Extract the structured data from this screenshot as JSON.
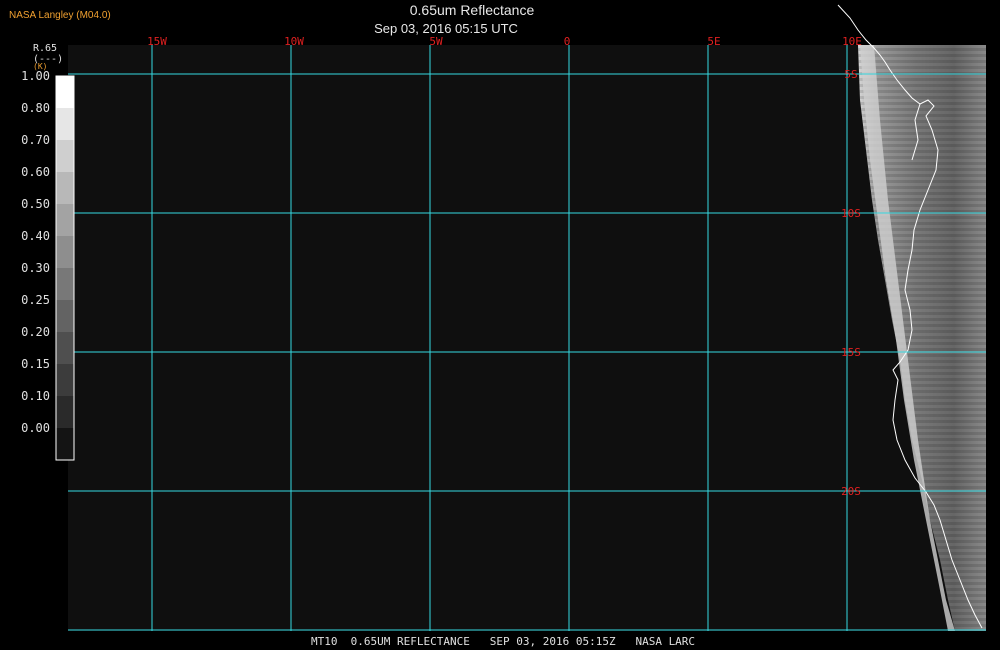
{
  "header": {
    "organization": "NASA Langley (M04.0)",
    "title": "0.65um Reflectance",
    "subtitle": "Sep 03, 2016 05:15 UTC"
  },
  "legend": {
    "variable": "R.65",
    "units": "(---)",
    "units_small": "(K)",
    "labels": [
      "1.00",
      "0.80",
      "0.70",
      "0.60",
      "0.50",
      "0.40",
      "0.30",
      "0.25",
      "0.20",
      "0.15",
      "0.10",
      "0.00"
    ],
    "ramp_colors": [
      "#ffffff",
      "#e6e6e6",
      "#cfcfcf",
      "#b8b8b8",
      "#a3a3a3",
      "#8e8e8e",
      "#787878",
      "#636363",
      "#4f4f4f",
      "#3c3c3c",
      "#2a2a2a",
      "#141414"
    ]
  },
  "grid": {
    "longitude_labels": [
      "15W",
      "10W",
      "5W",
      "0",
      "5E",
      "10E"
    ],
    "latitude_labels": [
      "5S",
      "10S",
      "15S",
      "20S"
    ],
    "line_color": "#35d8e0",
    "label_color": "#e02020"
  },
  "footer": {
    "text": "MT10  0.65UM REFLECTANCE   SEP 03, 2016 05:15Z   NASA LARC"
  },
  "colors": {
    "background": "#000000",
    "ocean": "#0f0f0f",
    "coastline": "#ffffff",
    "header_accent": "#f0a030"
  }
}
